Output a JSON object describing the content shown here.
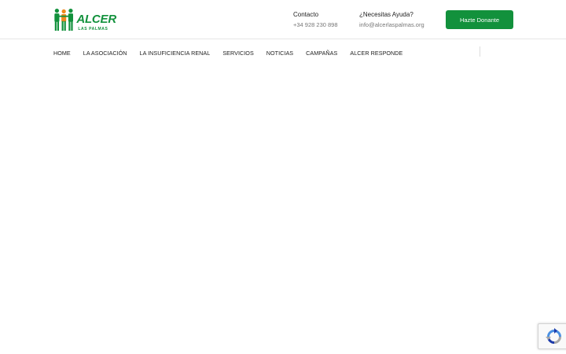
{
  "logo": {
    "word": "ALCER",
    "subtitle": "LAS PALMAS"
  },
  "header": {
    "contact": {
      "title": "Contacto",
      "phone": "+34 928 230 898"
    },
    "help": {
      "title": "¿Necesitas Ayuda?",
      "email": "info@alcerlaspalmas.org"
    },
    "donate_label": "Hazte Donante"
  },
  "nav": {
    "items": [
      {
        "label": "HOME"
      },
      {
        "label": "LA ASOCIACIÓN"
      },
      {
        "label": "LA INSUFICIENCIA RENAL"
      },
      {
        "label": "SERVICIOS"
      },
      {
        "label": "NOTICIAS"
      },
      {
        "label": "CAMPAÑAS"
      },
      {
        "label": "ALCER RESPONDE"
      }
    ]
  },
  "colors": {
    "brand_green": "#12913c",
    "logo_orange": "#f08a1c"
  },
  "icons": {
    "recaptcha": "recaptcha-icon"
  }
}
